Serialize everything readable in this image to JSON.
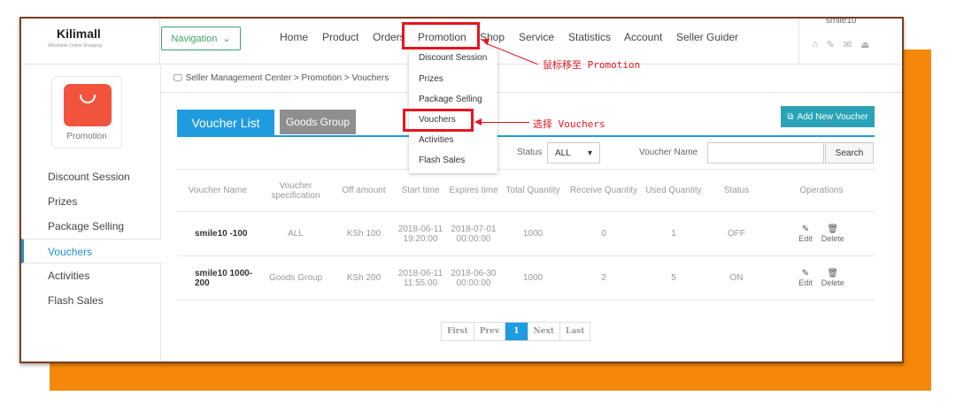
{
  "header": {
    "logo": "Kilimall",
    "logo_tagline": "Affordable Online Shopping",
    "navigation_button": "Navigation",
    "menu": [
      "Home",
      "Product",
      "Orders",
      "Promotion",
      "Shop",
      "Service",
      "Statistics",
      "Account",
      "Seller Guider"
    ],
    "username": "smile10"
  },
  "dropdown": {
    "items": [
      "Discount Session",
      "Prizes",
      "Package Selling",
      "Vouchers",
      "Activities",
      "Flash Sales"
    ]
  },
  "annotations": {
    "promotion_note": "鼠标移至 Promotion",
    "vouchers_note": "选择 Vouchers"
  },
  "sidebar": {
    "card_label": "Promotion",
    "items": [
      "Discount Session",
      "Prizes",
      "Package Selling",
      "Vouchers",
      "Activities",
      "Flash Sales"
    ],
    "active": "Vouchers"
  },
  "breadcrumb": "Seller Management Center > Promotion > Vouchers",
  "tabs": {
    "active": "Voucher List",
    "inactive": "Goods Group"
  },
  "add_button": "Add New Voucher",
  "filters": {
    "status_label": "Status",
    "status_value": "ALL",
    "voucher_name_label": "Voucher Name",
    "voucher_name_value": "",
    "search_button": "Search"
  },
  "table": {
    "headers": [
      "Voucher Name",
      "Voucher specification",
      "Off amount",
      "Start time",
      "Expires time",
      "Total Quantity",
      "Receive Quantity",
      "Used Quantity",
      "Status",
      "Operations"
    ],
    "rows": [
      {
        "name": "smile10 -100",
        "spec": "ALL",
        "off": "KSh 100",
        "start_date": "2018-06-11",
        "start_time": "19:20:00",
        "exp_date": "2018-07-01",
        "exp_time": "00:00:00",
        "total": "1000",
        "received": "0",
        "used": "1",
        "status": "OFF"
      },
      {
        "name": "smile10 1000-200",
        "spec": "Goods Group",
        "off": "KSh 200",
        "start_date": "2018-06-11",
        "start_time": "11:55:00",
        "exp_date": "2018-06-30",
        "exp_time": "00:00:00",
        "total": "1000",
        "received": "2",
        "used": "5",
        "status": "ON"
      }
    ],
    "edit_label": "Edit",
    "delete_label": "Delete"
  },
  "pager": {
    "first": "First",
    "prev": "Prev",
    "current": "1",
    "next": "Next",
    "last": "Last"
  },
  "colors": {
    "accent_blue": "#1f9be0",
    "highlight_red": "#e8141e",
    "orange_bg": "#f5880a"
  }
}
